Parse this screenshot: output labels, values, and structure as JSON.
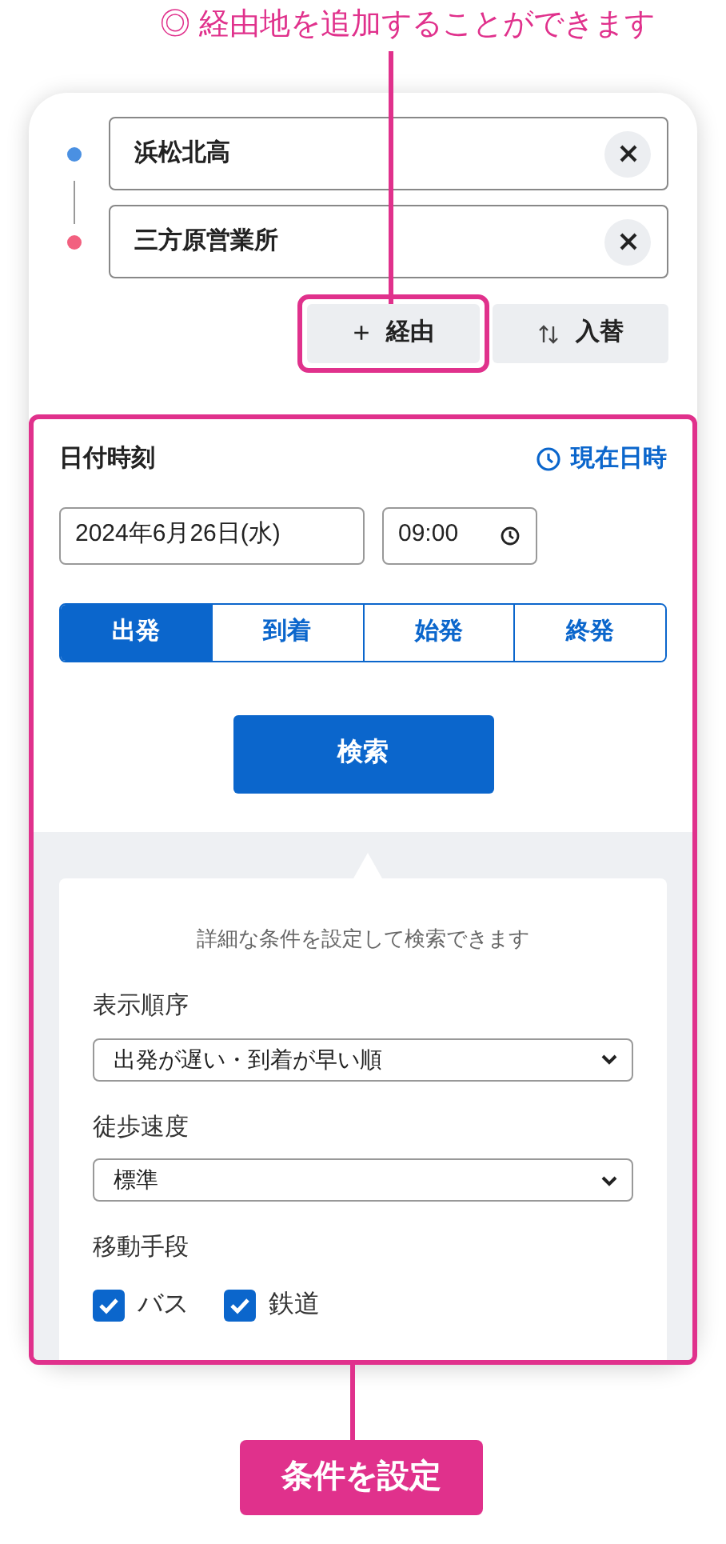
{
  "annotations": {
    "top_callout": "◎ 経由地を追加することができます",
    "bottom_label": "条件を設定"
  },
  "stops": [
    {
      "name": "浜松北高",
      "color": "#4a90e2"
    },
    {
      "name": "三方原営業所",
      "color": "#f2607f"
    }
  ],
  "via_button": {
    "icon": "+",
    "label": "経由"
  },
  "swap_button": {
    "label": "入替"
  },
  "datetime": {
    "title": "日付時刻",
    "now_link": "現在日時",
    "date": "2024年6月26日(水)",
    "time": "09:00"
  },
  "modes": [
    {
      "label": "出発",
      "selected": true
    },
    {
      "label": "到着",
      "selected": false
    },
    {
      "label": "始発",
      "selected": false
    },
    {
      "label": "終発",
      "selected": false
    }
  ],
  "search_button": "検索",
  "conditions": {
    "intro": "詳細な条件を設定して検索できます",
    "fields": [
      {
        "kind": "select",
        "label": "表示順序",
        "value": "出発が遅い・到着が早い順"
      },
      {
        "kind": "select",
        "label": "徒歩速度",
        "value": "標準"
      },
      {
        "kind": "checks",
        "label": "移動手段",
        "options": [
          {
            "label": "バス",
            "checked": true
          },
          {
            "label": "鉄道",
            "checked": true
          }
        ]
      }
    ]
  }
}
